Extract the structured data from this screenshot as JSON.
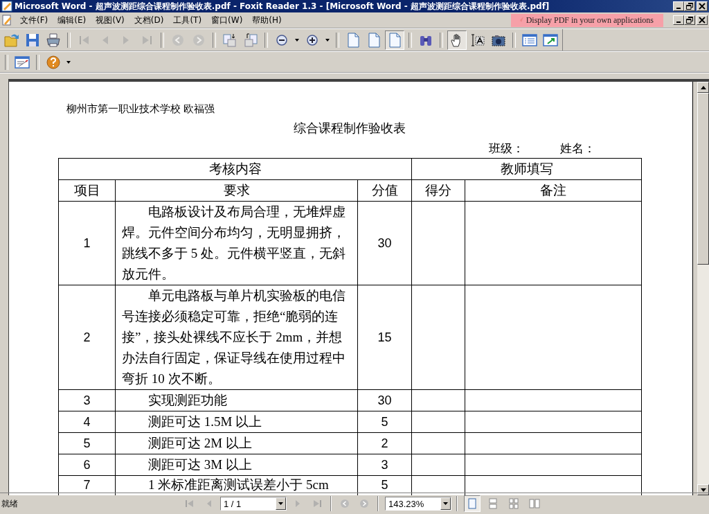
{
  "window": {
    "title": "Microsoft Word - 超声波测距综合课程制作验收表.pdf - Foxit Reader 1.3 - [Microsoft Word - 超声波测距综合课程制作验收表.pdf]"
  },
  "menu": [
    {
      "label": "文件(F)"
    },
    {
      "label": "编辑(E)"
    },
    {
      "label": "视图(V)"
    },
    {
      "label": "文档(D)"
    },
    {
      "label": "工具(T)"
    },
    {
      "label": "窗口(W)"
    },
    {
      "label": "帮助(H)"
    }
  ],
  "ad_banner": {
    "label": "Display PDF in your own applications"
  },
  "toolbar_groups": [
    [
      {
        "kind": "open",
        "disabled": false,
        "selected": false
      },
      {
        "kind": "save",
        "disabled": false,
        "selected": false
      },
      {
        "kind": "print",
        "disabled": false,
        "selected": false
      }
    ],
    [
      {
        "kind": "first",
        "disabled": true,
        "selected": false
      },
      {
        "kind": "prev",
        "disabled": true,
        "selected": false
      },
      {
        "kind": "next",
        "disabled": true,
        "selected": false
      },
      {
        "kind": "last",
        "disabled": true,
        "selected": false
      }
    ],
    [
      {
        "kind": "back",
        "disabled": true,
        "selected": false
      },
      {
        "kind": "forward",
        "disabled": true,
        "selected": false
      }
    ],
    [
      {
        "kind": "rotate-cw",
        "disabled": false,
        "selected": false
      },
      {
        "kind": "rotate-ccw",
        "disabled": false,
        "selected": false
      }
    ],
    [
      {
        "kind": "zoom-out",
        "disabled": false,
        "selected": false
      },
      {
        "kind": "caret",
        "disabled": false,
        "selected": false
      },
      {
        "kind": "zoom-in",
        "disabled": false,
        "selected": false
      },
      {
        "kind": "caret",
        "disabled": false,
        "selected": false
      }
    ],
    [
      {
        "kind": "page",
        "disabled": false,
        "selected": false
      },
      {
        "kind": "page",
        "disabled": false,
        "selected": false
      },
      {
        "kind": "page",
        "disabled": false,
        "selected": true
      }
    ],
    [
      {
        "kind": "find",
        "disabled": false,
        "selected": false
      }
    ],
    [
      {
        "kind": "hand",
        "disabled": false,
        "selected": true
      },
      {
        "kind": "text-select",
        "disabled": false,
        "selected": false
      },
      {
        "kind": "snapshot",
        "disabled": false,
        "selected": false
      }
    ],
    [
      {
        "kind": "bookmarks",
        "disabled": false,
        "selected": false
      },
      {
        "kind": "export",
        "disabled": false,
        "selected": false
      }
    ]
  ],
  "toolbar2_groups": [
    [
      {
        "kind": "annotate",
        "disabled": false,
        "selected": false
      }
    ],
    [
      {
        "kind": "help",
        "disabled": false,
        "selected": false
      },
      {
        "kind": "caret",
        "disabled": false,
        "selected": false
      }
    ]
  ],
  "document": {
    "author_line": "柳州市第一职业技术学校 欧福强",
    "title": "综合课程制作验收表",
    "class_label": "班级：",
    "name_label": "姓名：",
    "table": {
      "group_headers": [
        "考核内容",
        "教师填写"
      ],
      "columns": [
        "项目",
        "要求",
        "分值",
        "得分",
        "备注"
      ],
      "rows": [
        {
          "item": "1",
          "requirement": "电路板设计及布局合理，无堆焊虚焊。元件空间分布均匀，无明显拥挤，跳线不多于 5 处。元件横平竖直，无斜放元件。",
          "score": "30"
        },
        {
          "item": "2",
          "requirement": "单元电路板与单片机实验板的电信号连接必须稳定可靠，拒绝“脆弱的连接”，接头处裸线不应长于 2mm，并想办法自行固定，保证导线在使用过程中弯折 10 次不断。",
          "score": "15"
        },
        {
          "item": "3",
          "requirement": "实现测距功能",
          "score": "30"
        },
        {
          "item": "4",
          "requirement": "测距可达 1.5M 以上",
          "score": "5"
        },
        {
          "item": "5",
          "requirement": "测距可达 2M 以上",
          "score": "2"
        },
        {
          "item": "6",
          "requirement": "测距可达 3M 以上",
          "score": "3"
        },
        {
          "item": "7",
          "requirement": "1 米标准距离测试误差小于 5cm",
          "score": "5"
        }
      ]
    }
  },
  "status_bar": {
    "status": "就绪",
    "page_field": "1 / 1",
    "zoom_field": "143.23%",
    "view_modes": [
      {
        "selected": true
      },
      {
        "selected": false
      },
      {
        "selected": false
      },
      {
        "selected": false
      }
    ]
  }
}
